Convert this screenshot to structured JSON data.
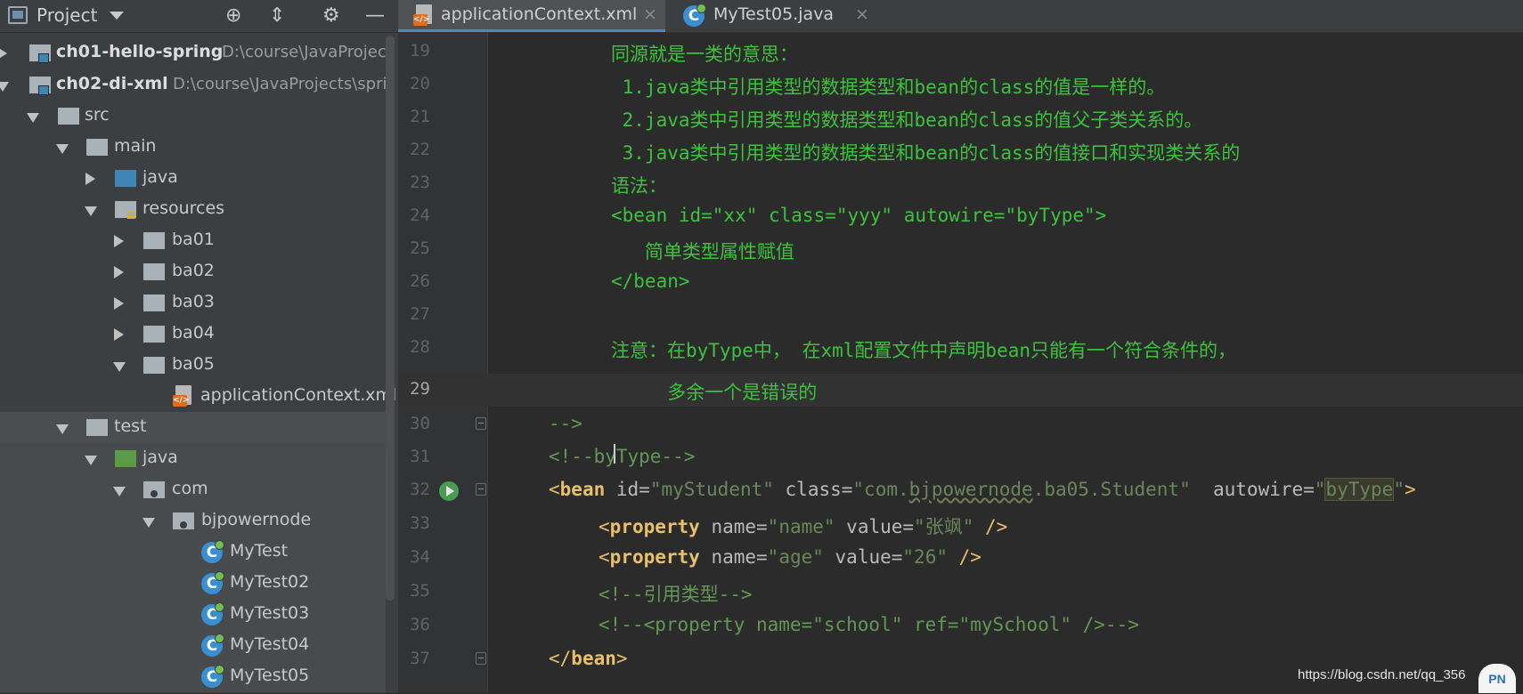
{
  "project_panel": {
    "title": "Project",
    "tree": [
      {
        "label": "ch01-hello-spring",
        "path": "D:\\course\\JavaProjec",
        "kind": "module"
      },
      {
        "label": "ch02-di-xml",
        "path": "D:\\course\\JavaProjects\\spri",
        "kind": "module"
      },
      {
        "label": "src",
        "kind": "folder"
      },
      {
        "label": "main",
        "kind": "folder"
      },
      {
        "label": "java",
        "kind": "source-folder"
      },
      {
        "label": "resources",
        "kind": "resources-folder"
      },
      {
        "label": "ba01",
        "kind": "folder"
      },
      {
        "label": "ba02",
        "kind": "folder"
      },
      {
        "label": "ba03",
        "kind": "folder"
      },
      {
        "label": "ba04",
        "kind": "folder"
      },
      {
        "label": "ba05",
        "kind": "folder"
      },
      {
        "label": "applicationContext.xml",
        "kind": "xml-file"
      },
      {
        "label": "test",
        "kind": "folder"
      },
      {
        "label": "java",
        "kind": "test-source-folder"
      },
      {
        "label": "com",
        "kind": "package"
      },
      {
        "label": "bjpowernode",
        "kind": "package"
      },
      {
        "label": "MyTest",
        "kind": "class"
      },
      {
        "label": "MyTest02",
        "kind": "class"
      },
      {
        "label": "MyTest03",
        "kind": "class"
      },
      {
        "label": "MyTest04",
        "kind": "class"
      },
      {
        "label": "MyTest05",
        "kind": "class"
      }
    ]
  },
  "tabs": [
    {
      "label": "applicationContext.xml",
      "close": "×"
    },
    {
      "label": "MyTest05.java",
      "close": "×"
    }
  ],
  "editor": {
    "line_numbers": [
      "19",
      "20",
      "21",
      "22",
      "23",
      "24",
      "25",
      "26",
      "27",
      "28",
      "29",
      "30",
      "31",
      "32",
      "33",
      "34",
      "35",
      "36",
      "37"
    ],
    "lines": {
      "l19": "同源就是一类的意思：",
      "l20": " 1.java类中引用类型的数据类型和bean的class的值是一样的。",
      "l21": " 2.java类中引用类型的数据类型和bean的class的值父子类关系的。",
      "l22": " 3.java类中引用类型的数据类型和bean的class的值接口和实现类关系的",
      "l23": "语法：",
      "l24": "<bean id=\"xx\" class=\"yyy\" autowire=\"byType\">",
      "l25": "   简单类型属性赋值",
      "l26": "</bean>",
      "l28": "注意：在byType中， 在xml配置文件中声明bean只能有一个符合条件的，",
      "l29": "     多余一个是错误的",
      "l30": "-->",
      "l31": "<!--byType-->",
      "l32": {
        "open": "<",
        "tag": "bean",
        "attr_id": " id=",
        "val_id": "\"myStudent\"",
        "attr_class": " class=",
        "val_class_q1": "\"com.",
        "val_class_sq": "bjpowernode",
        "val_class_rest": ".ba05.Student\"",
        "attr_autowire": "  autowire=",
        "q1": "\"",
        "val_autowire": "byType",
        "q2": "\"",
        "close": ">"
      },
      "l33": {
        "open": "<",
        "tag": "property",
        "attr_name": " name=",
        "val_name": "\"name\"",
        "attr_value": " value=",
        "val_value": "\"张飒\"",
        "close": " />"
      },
      "l34": {
        "open": "<",
        "tag": "property",
        "attr_name": " name=",
        "val_name": "\"age\"",
        "attr_value": " value=",
        "val_value": "\"26\"",
        "close": " />"
      },
      "l35": "<!--引用类型-->",
      "l36": "<!--<property name=\"school\" ref=\"mySchool\" />-->",
      "l37": {
        "open": "</",
        "tag": "bean",
        "close": ">"
      }
    }
  },
  "watermark": "https://blog.csdn.net/qq_356",
  "logo_text": "PN",
  "colors": {
    "panel_bg": "#3c3f41",
    "editor_bg": "#2b2b2b",
    "comment_green": "#629755",
    "bright_green_text": "#3cc23c",
    "tag_yellow": "#e8bf6a",
    "string_green": "#6a8759",
    "tab_underline": "#4a88c7"
  }
}
